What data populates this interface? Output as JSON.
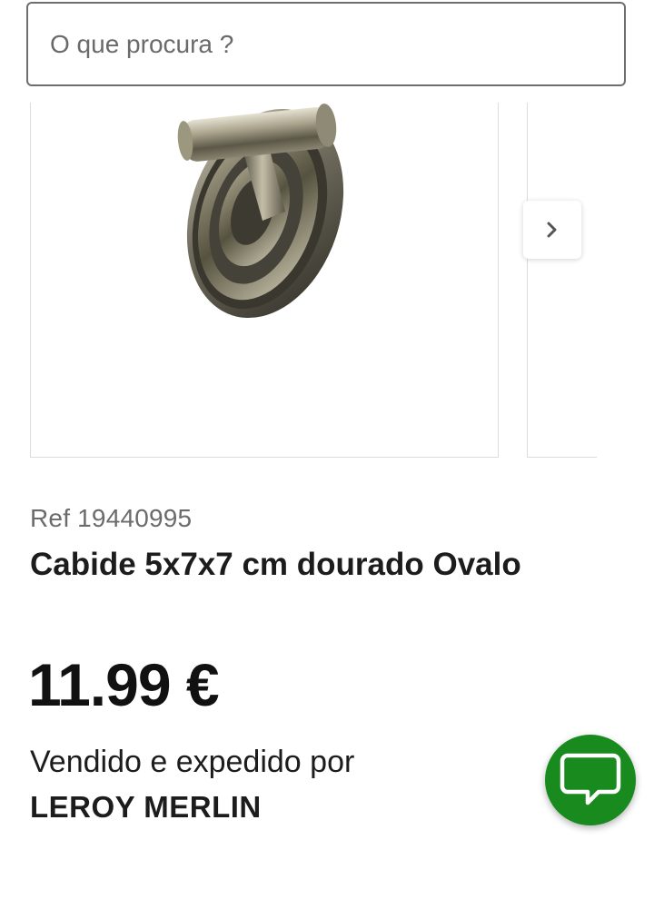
{
  "search": {
    "placeholder": "O que procura ?",
    "value": ""
  },
  "gallery": {
    "product_image_icon": "coat-hook-product-photo",
    "next_icon": "chevron-right-icon"
  },
  "product": {
    "ref": "Ref 19440995",
    "title": "Cabide 5x7x7 cm dourado Ovalo",
    "price": "11.99 €"
  },
  "seller": {
    "sold_by_label": "Vendido e expedido por",
    "name": "LEROY MERLIN"
  },
  "chat": {
    "icon": "chat-bubble-icon",
    "color": "#188a1e"
  },
  "colors": {
    "text": "#1c1c1c",
    "muted": "#6b6b6b",
    "border": "#dcdcdc",
    "accent_green": "#188a1e"
  }
}
